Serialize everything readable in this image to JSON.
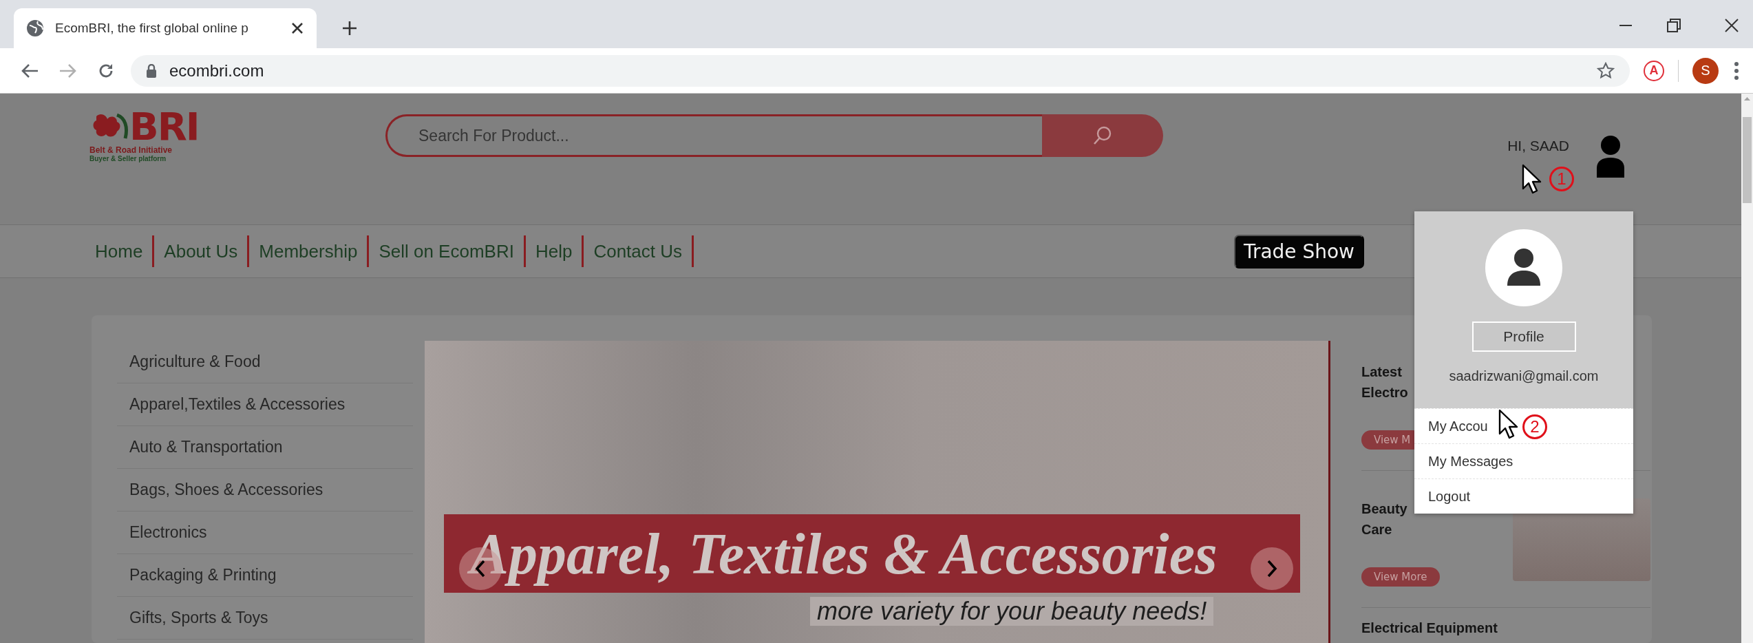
{
  "browser": {
    "tab": {
      "title": "EcomBRI, the first global online p"
    },
    "forward": {
      "disabled": true
    },
    "url": "ecombri.com",
    "extension_badge": "A",
    "profile_initial": "S"
  },
  "header": {
    "logo": {
      "mark": "BRI",
      "line1": "Belt & Road Initiative",
      "line2": "Buyer & Seller platform"
    },
    "search": {
      "placeholder": "Search For Product..."
    },
    "greeting": "HI, SAAD"
  },
  "nav": {
    "items": [
      "Home",
      "About Us",
      "Membership",
      "Sell on EcomBRI",
      "Help",
      "Contact Us"
    ],
    "trade_show": "Trade Show"
  },
  "categories": [
    "Agriculture & Food",
    "Apparel,Textiles & Accessories",
    "Auto & Transportation",
    "Bags, Shoes & Accessories",
    "Electronics",
    "Packaging & Printing",
    "Gifts, Sports & Toys"
  ],
  "banner": {
    "headline": "Apparel, Textiles & Accessories",
    "tagline": "more variety for your beauty needs!"
  },
  "promos": [
    {
      "title_lines": [
        "Latest",
        "Electro"
      ],
      "button": "View M"
    },
    {
      "title_lines": [
        "Beauty",
        "Care"
      ],
      "button": "View More",
      "has_image": true
    },
    {
      "title_lines": [
        "Electrical Equipment"
      ]
    }
  ],
  "account_menu": {
    "profile_button": "Profile",
    "email": "saadrizwani@gmail.com",
    "items": [
      "My Accou",
      "My Messages",
      "Logout"
    ]
  },
  "annotations": [
    {
      "number": "1"
    },
    {
      "number": "2"
    }
  ]
}
